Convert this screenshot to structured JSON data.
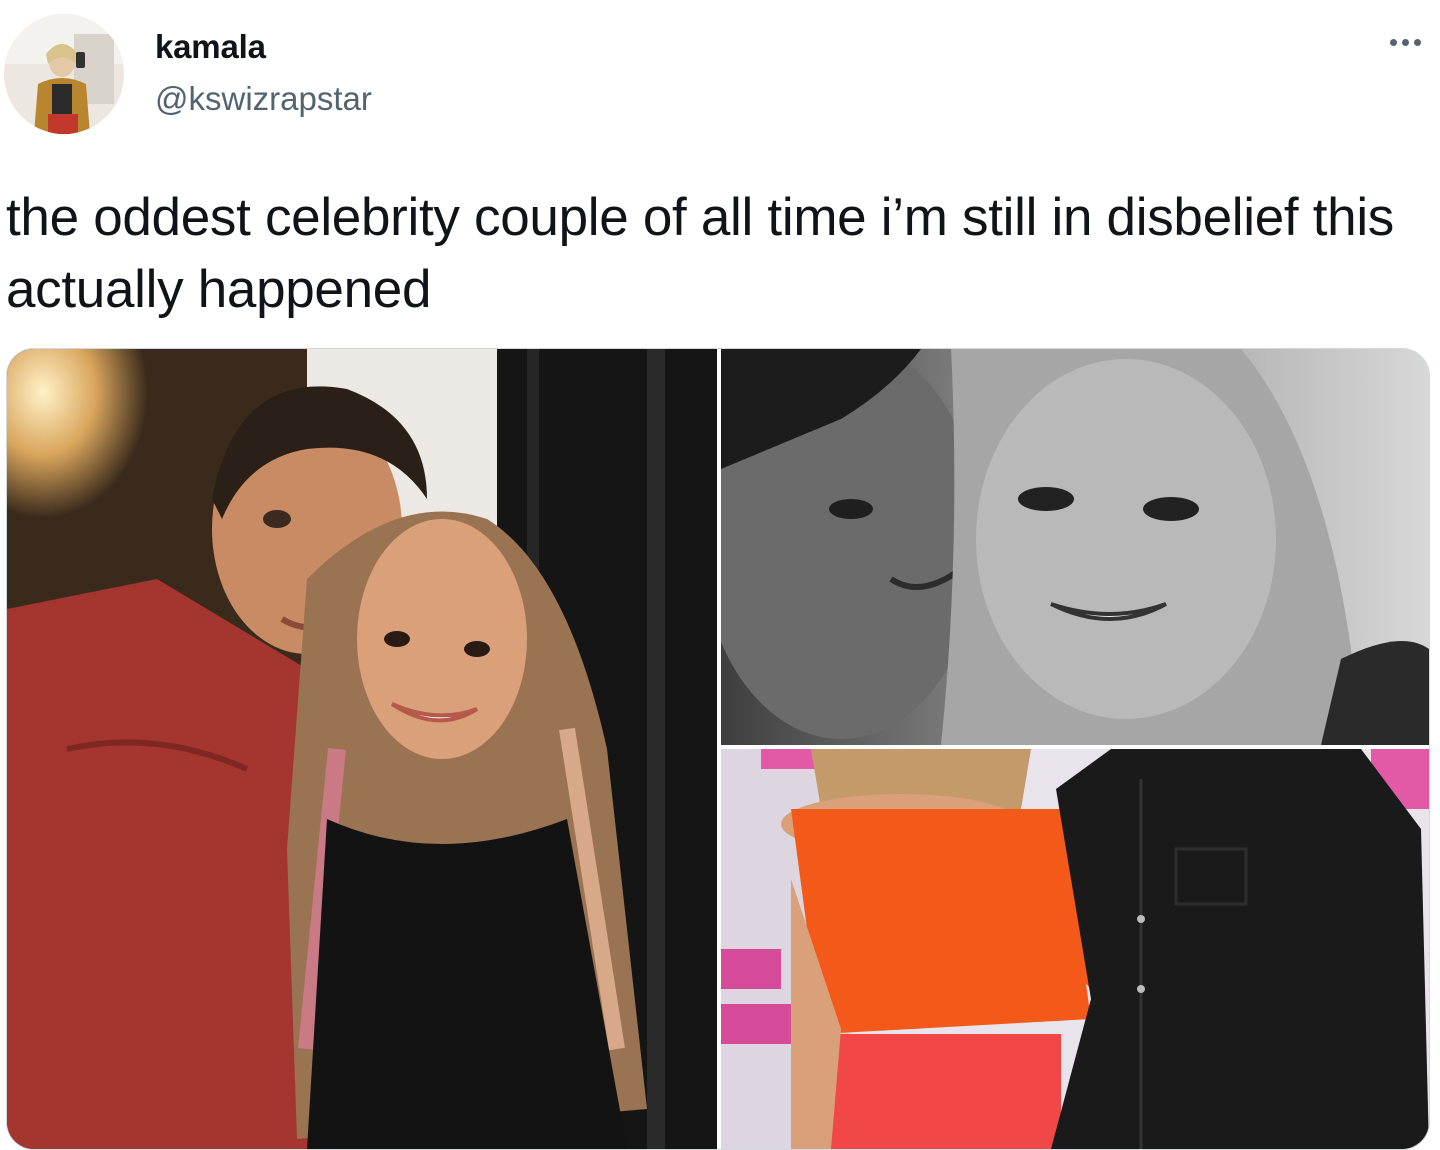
{
  "user": {
    "display_name": "kamala",
    "handle": "@kswizrapstar",
    "avatar_icon": "profile-photo"
  },
  "more_icon": "more-horizontal-icon",
  "tweet": {
    "text": "the oddest celebrity couple of all time i’m still in disbelief this actually happened"
  },
  "colors": {
    "text": "#0f1419",
    "secondary": "#536471",
    "border": "#cfd9de"
  }
}
